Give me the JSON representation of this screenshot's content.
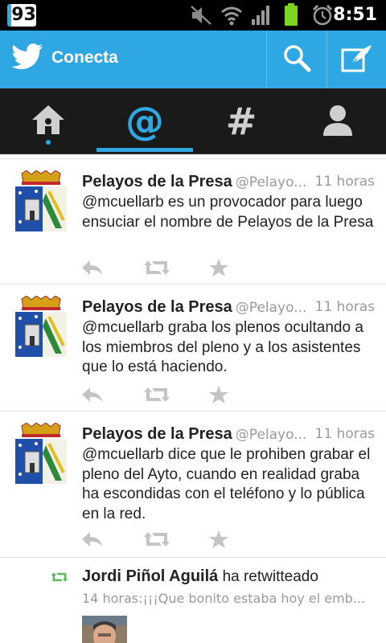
{
  "status_bar": {
    "notification_count": "93",
    "time": "8:51",
    "icons": [
      "mute-icon",
      "wifi-icon",
      "signal-icon",
      "battery-icon",
      "alarm-icon"
    ],
    "battery_color": "#7ed321"
  },
  "action_bar": {
    "title": "Conecta",
    "accent": "#2ea7e3",
    "buttons": [
      "search-icon",
      "compose-icon"
    ]
  },
  "tabs": [
    {
      "id": "home",
      "icon": "home-icon",
      "active": false
    },
    {
      "id": "mentions",
      "icon": "at-icon",
      "glyph": "@",
      "active": true
    },
    {
      "id": "discover",
      "icon": "hash-icon",
      "glyph": "#",
      "active": false
    },
    {
      "id": "me",
      "icon": "profile-icon",
      "active": false
    }
  ],
  "tweets": [
    {
      "name": "Pelayos de la Presa",
      "handle": "@Pelayo...",
      "time": "11 horas",
      "text": "@mcuellarb es un provocador para luego ensuciar el nombre de Pelayos de la Presa"
    },
    {
      "name": "Pelayos de la Presa",
      "handle": "@Pelayo...",
      "time": "11 horas",
      "text": "@mcuellarb graba los plenos ocultando a los miembros del pleno y a los asistentes que lo está haciendo."
    },
    {
      "name": "Pelayos de la Presa",
      "handle": "@Pelayo...",
      "time": "11 horas",
      "text": "@mcuellarb dice que le prohiben grabar el pleno del Ayto, cuando en realidad graba ha escondidas con el teléfono y lo pública en la red."
    }
  ],
  "retweet": {
    "name": "Jordi Piñol Aguilá",
    "action": "ha retwitteado",
    "summary": "14 horas:¡¡¡Que bonito estaba hoy el emb..."
  }
}
